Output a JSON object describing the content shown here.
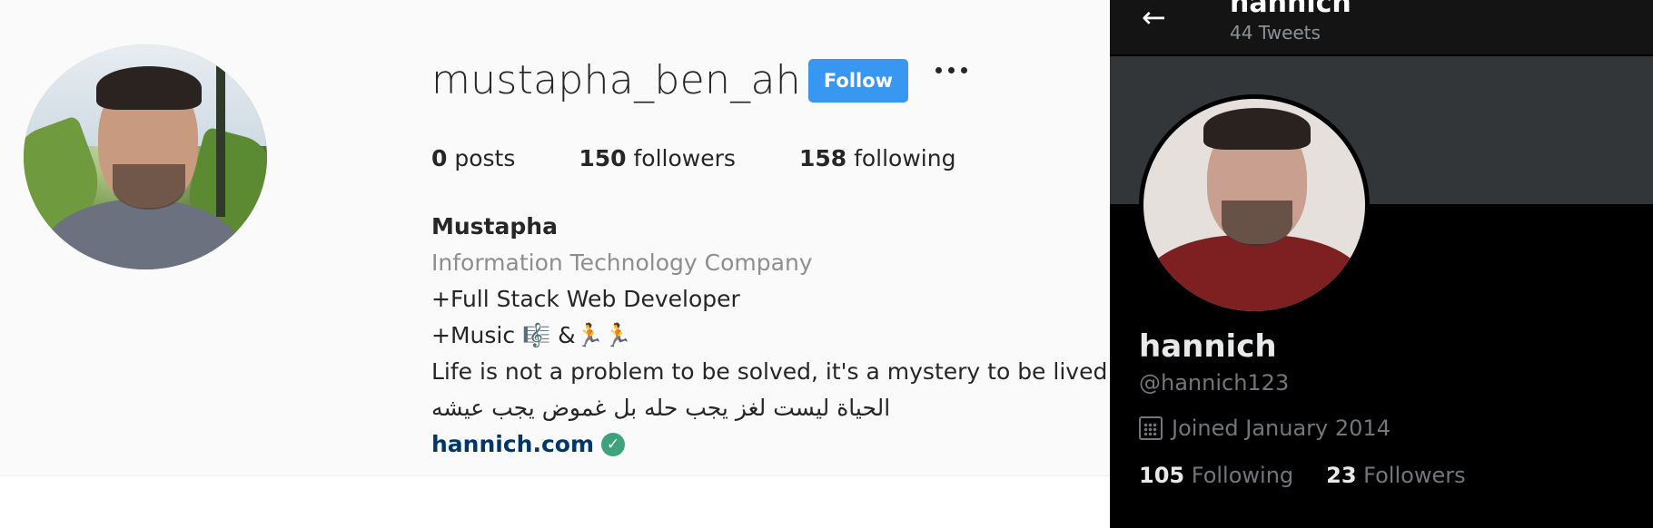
{
  "instagram": {
    "username": "mustapha_ben_ah",
    "follow_label": "Follow",
    "stats": {
      "posts_count": "0",
      "posts_label": " posts",
      "followers_count": "150",
      "followers_label": " followers",
      "following_count": "158",
      "following_label": " following"
    },
    "bio": {
      "name": "Mustapha",
      "category": "Information Technology Company",
      "line1": "+Full Stack Web Developer",
      "line2": "+Music 🎼 &🏃🏃",
      "line3": "Life is not a problem to be solved, it's a mystery to be lived.",
      "line4": "الحياة ليست لغز يجب حله بل غموض يجب عيشه",
      "link": "hannich.com"
    }
  },
  "twitter": {
    "header_title": "hannich",
    "header_subtitle": "44 Tweets",
    "name": "hannich",
    "handle": "@hannich123",
    "joined": "Joined January 2014",
    "following_count": "105",
    "following_label": " Following",
    "followers_count": "23",
    "followers_label": " Followers"
  },
  "colors": {
    "follow_button": "#3897f0",
    "verified": "#3ea37c",
    "twitter_bg": "#000000",
    "twitter_banner": "#333639"
  }
}
